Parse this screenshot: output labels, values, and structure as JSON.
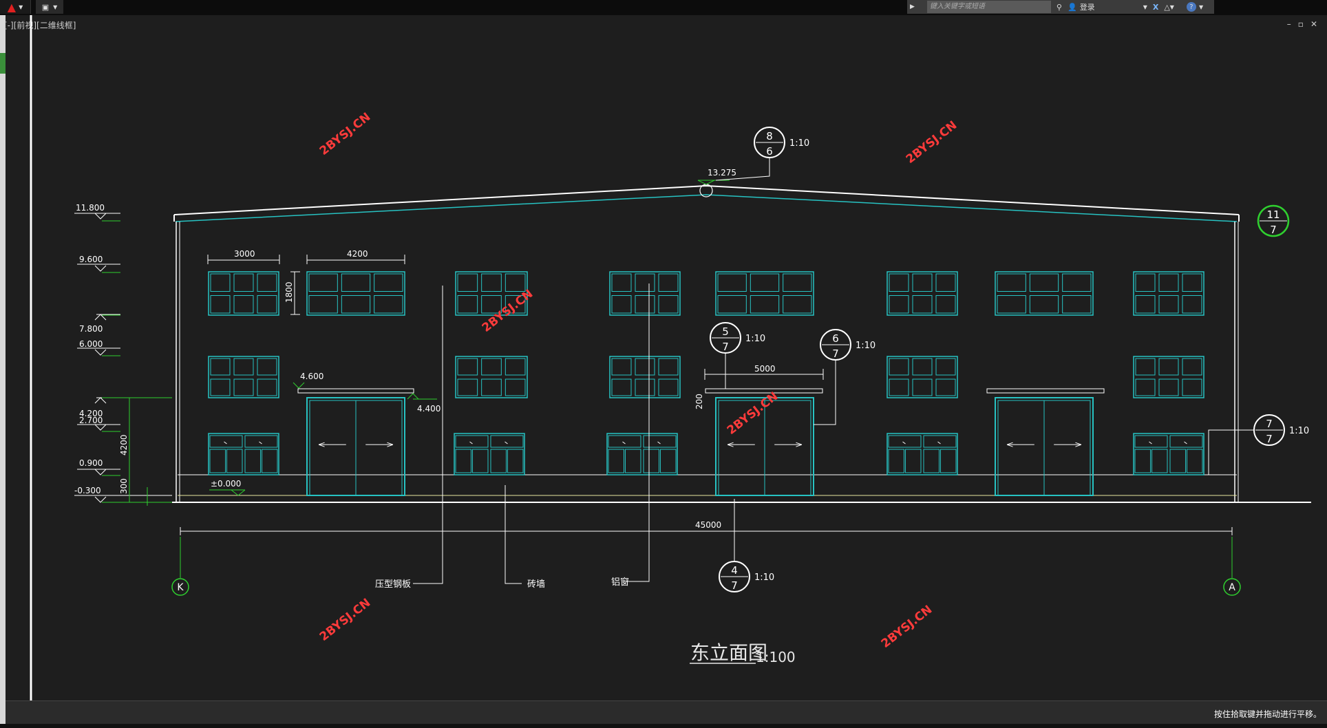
{
  "titlebar": {
    "search_placeholder": "键入关键字或短语",
    "login_label": "登录"
  },
  "viewport": {
    "view_label": "[-][前视][二维线框]",
    "win_min": "–",
    "win_restore": "▫",
    "win_close": "✕"
  },
  "drawing": {
    "title": "东立面图",
    "scale": "1:100",
    "watermark": "2BYSJ.CN",
    "elevations": [
      "11.800",
      "9.600",
      "7.800",
      "6.000",
      "4.200",
      "2.700",
      "0.900",
      "-0.300"
    ],
    "ridge_elevation": "13.275",
    "canopy_left": "4.600",
    "canopy_right": "4.400",
    "ground_label": "±0.000",
    "dim_3000": "3000",
    "dim_4200": "4200",
    "dim_1800": "1800",
    "dim_5000": "5000",
    "dim_200": "200",
    "dim_total": "45000",
    "dim_side_4200": "4200",
    "dim_side_300": "300",
    "axis_left": "K",
    "axis_right": "A",
    "callout_8_6": {
      "top": "8",
      "bottom": "6",
      "scale": "1:10"
    },
    "callout_5_7": {
      "top": "5",
      "bottom": "7",
      "scale": "1:10"
    },
    "callout_6_7": {
      "top": "6",
      "bottom": "7",
      "scale": "1:10"
    },
    "callout_7_7": {
      "top": "7",
      "bottom": "7",
      "scale": "1:10"
    },
    "callout_4_7": {
      "top": "4",
      "bottom": "7",
      "scale": "1:10"
    },
    "callout_11_7": {
      "top": "11",
      "bottom": "7"
    },
    "label_steel": "压型钢板",
    "label_brick": "砖墙",
    "label_alum": "铝窗"
  },
  "status": {
    "message": "按住拾取键并拖动进行平移。"
  }
}
